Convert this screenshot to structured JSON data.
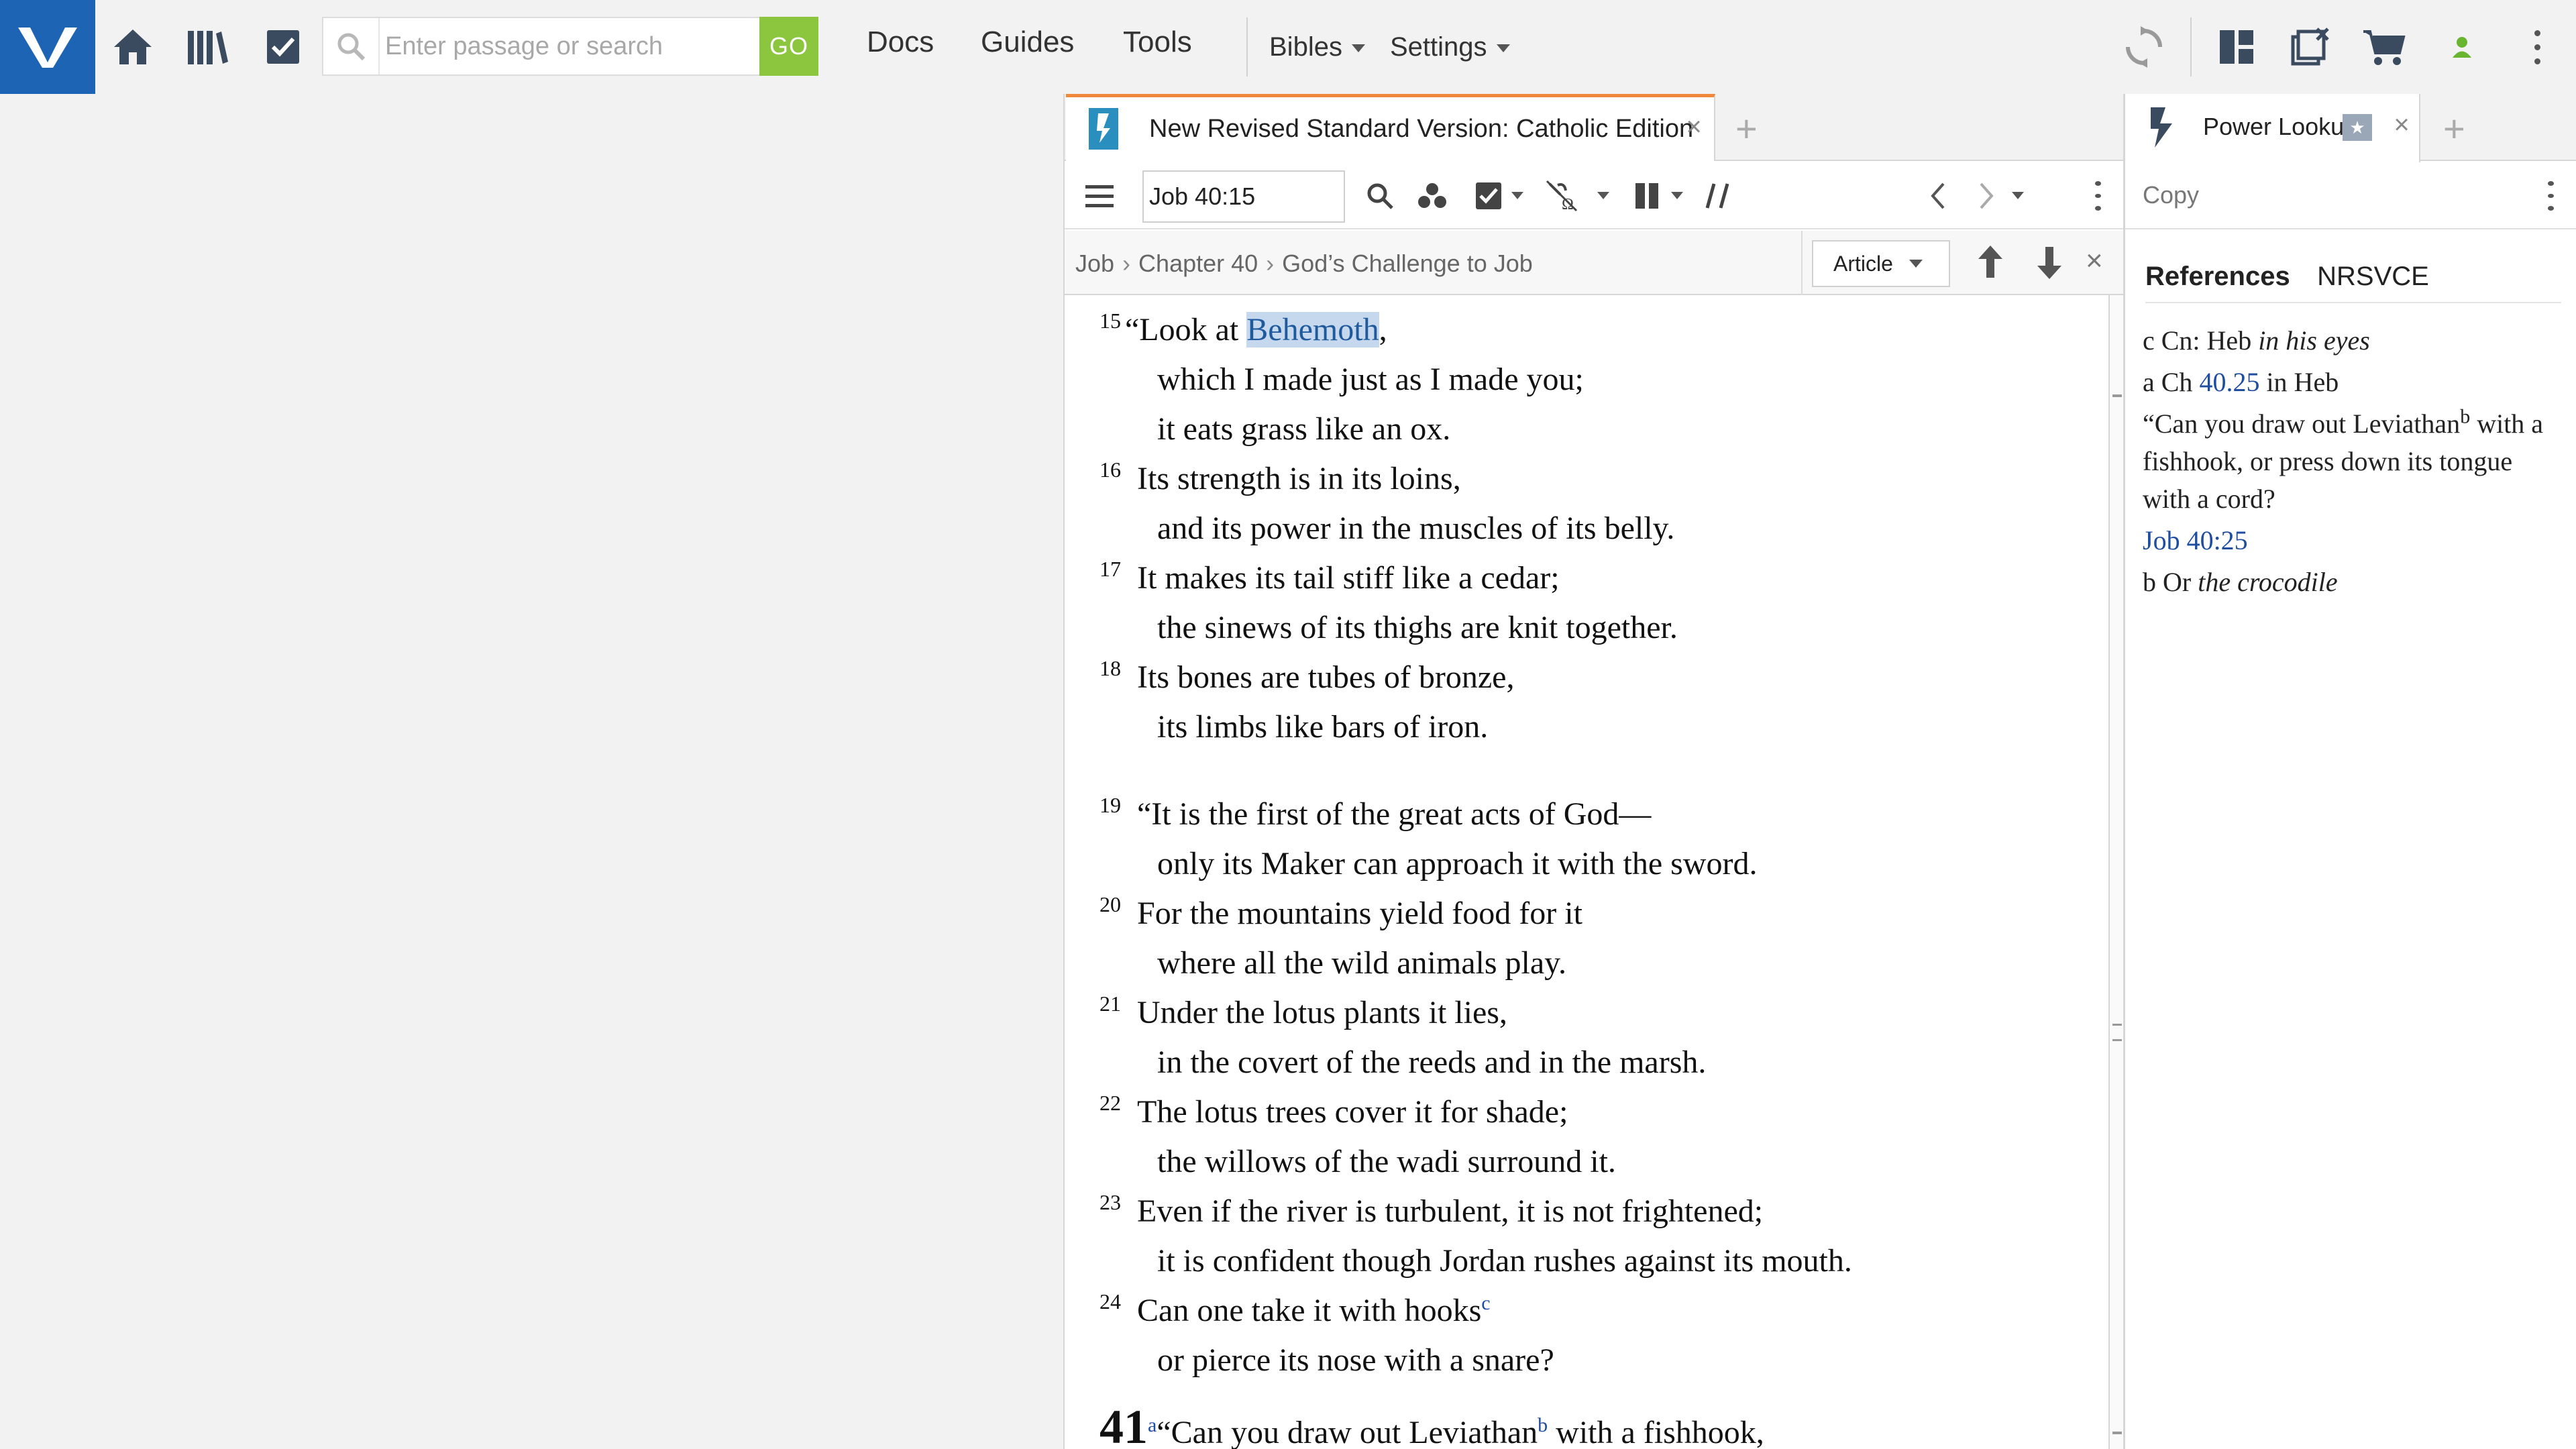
{
  "search": {
    "placeholder": "Enter passage or search",
    "go_label": "GO"
  },
  "nav": {
    "docs": "Docs",
    "guides": "Guides",
    "tools": "Tools",
    "bibles": "Bibles",
    "settings": "Settings"
  },
  "colors": {
    "brand_blue": "#1e64b4",
    "go_green": "#8cc63f",
    "active_tab_accent": "#f0883c",
    "link_blue": "#1f4ea1",
    "highlight": "#c5d8ee",
    "account_dot": "#69b530"
  },
  "icons": [
    "app-logo-icon",
    "home-icon",
    "library-icon",
    "checklist-icon",
    "search-icon",
    "sync-icon",
    "layouts-icon",
    "close-all-icon",
    "cart-icon",
    "account-icon",
    "more-icon"
  ],
  "bible_panel": {
    "tab_title": "New Revised Standard Version: Catholic Edition",
    "reference": "Job 40:15",
    "breadcrumb": [
      "Job",
      "Chapter 40",
      "God’s Challenge to Job"
    ],
    "article_label": "Article",
    "text": [
      {
        "verse": "15",
        "pre": "“Look at ",
        "highlight": "Behemoth",
        "post": ",",
        "indent": false
      },
      {
        "text": "which I made just as I made you;",
        "indent": true
      },
      {
        "text": "it eats grass like an ox.",
        "indent": true
      },
      {
        "verse": "16",
        "text": "Its strength is in its loins,",
        "indent": false
      },
      {
        "text": "and its power in the muscles of its belly.",
        "indent": true
      },
      {
        "verse": "17",
        "text": "It makes its tail stiff like a cedar;",
        "indent": false
      },
      {
        "text": "the sinews of its thighs are knit together.",
        "indent": true
      },
      {
        "verse": "18",
        "text": "Its bones are tubes of bronze,",
        "indent": false
      },
      {
        "text": "its limbs like bars of iron.",
        "indent": true
      },
      {
        "verse": "19",
        "text": "“It is the first of the great acts of God—",
        "indent": false
      },
      {
        "text": "only its Maker can approach it with the sword.",
        "indent": true
      },
      {
        "verse": "20",
        "text": "For the mountains yield food for it",
        "indent": false
      },
      {
        "text": "where all the wild animals play.",
        "indent": true
      },
      {
        "verse": "21",
        "text": "Under the lotus plants it lies,",
        "indent": false
      },
      {
        "text": "in the covert of the reeds and in the marsh.",
        "indent": true
      },
      {
        "verse": "22",
        "text": "The lotus trees cover it for shade;",
        "indent": false
      },
      {
        "text": "the willows of the wadi surround it.",
        "indent": true
      },
      {
        "verse": "23",
        "text": "Even if the river is turbulent, it is not frightened;",
        "indent": false
      },
      {
        "text": "it is confident though Jordan rushes against its mouth.",
        "indent": true
      },
      {
        "verse": "24",
        "text": "Can one take it with hooks",
        "note": "c",
        "indent": false
      },
      {
        "text": "or pierce its nose with a snare?",
        "indent": true
      },
      {
        "chapter": "41",
        "note_a": "a",
        "pre": "“Can you draw out Leviathan",
        "note": "b",
        "post": " with a fishhook,",
        "indent": false
      }
    ]
  },
  "lookup_panel": {
    "tab_title": "Power Lookup",
    "copy_label": "Copy",
    "heading": "References",
    "version": "NRSVCE",
    "notes": {
      "c_prefix": "c Cn: Heb ",
      "c_italic": "in his eyes",
      "a_prefix": "a Ch ",
      "a_link": "40.25",
      "a_suffix": " in Heb",
      "quote_pre": "“Can you draw out Leviathan",
      "quote_note": "b",
      "quote_post": " with a fishhook, or press down its tongue with a cord?",
      "ref_link": "Job 40:25",
      "b_prefix": "b Or ",
      "b_italic": "the crocodile"
    }
  }
}
